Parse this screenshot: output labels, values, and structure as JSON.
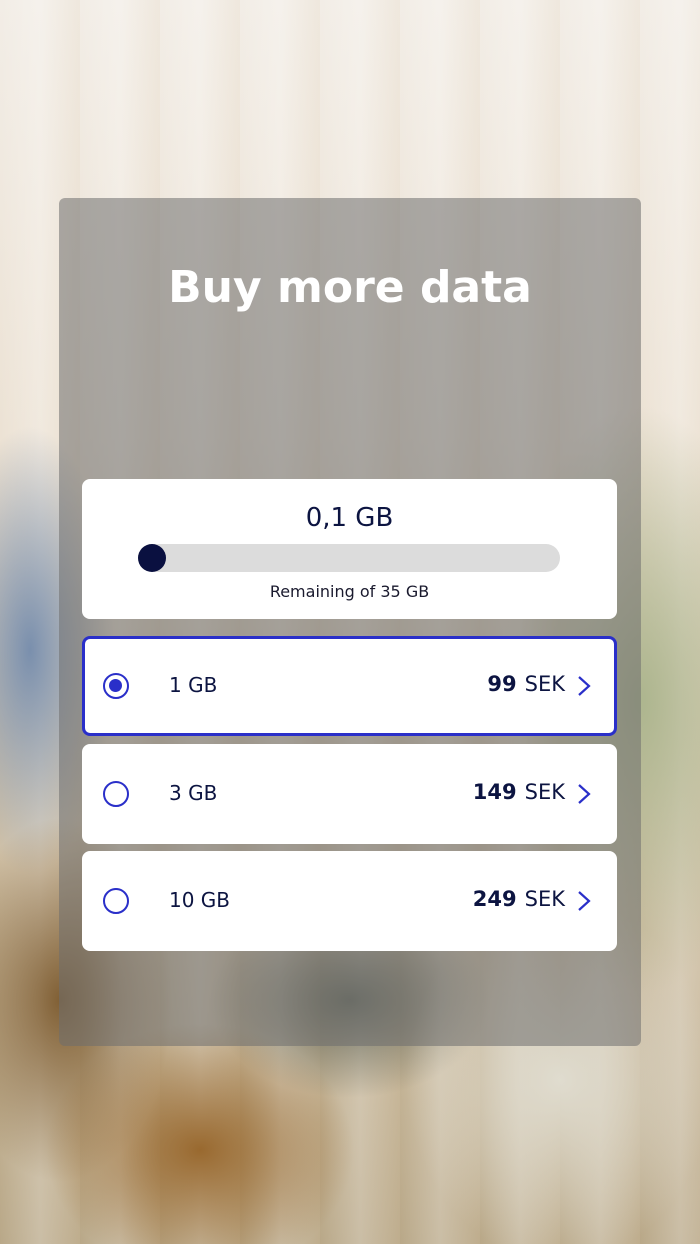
{
  "title": "Buy more data",
  "usage": {
    "value": "0,1 GB",
    "remaining_label": "Remaining of  35 GB",
    "fill_fraction": 0.003
  },
  "options": [
    {
      "label": "1 GB",
      "price": "99",
      "currency": "SEK",
      "selected": true
    },
    {
      "label": "3 GB",
      "price": "149",
      "currency": "SEK",
      "selected": false
    },
    {
      "label": "10 GB",
      "price": "249",
      "currency": "SEK",
      "selected": false
    }
  ],
  "colors": {
    "accent": "#2a2fc9",
    "text": "#0c1441",
    "progress": "#0a1040"
  }
}
